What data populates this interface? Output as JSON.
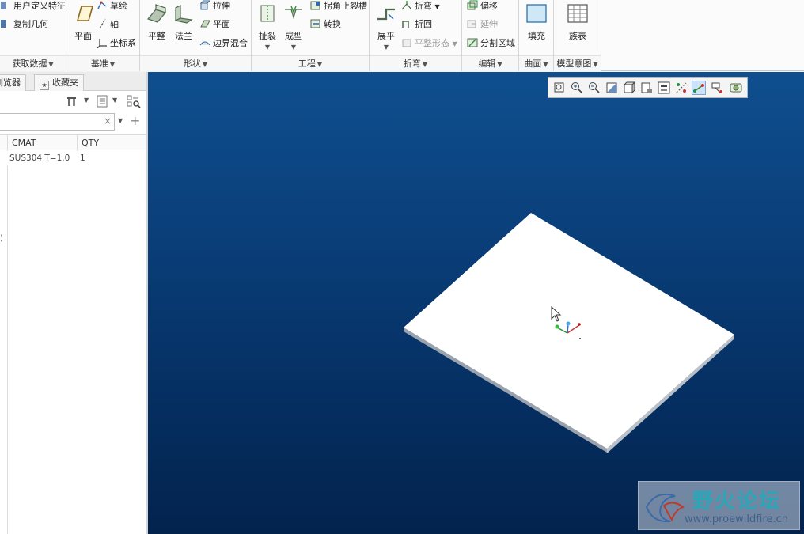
{
  "ribbon": {
    "get_data": {
      "label": "获取数据",
      "items": [
        "用户定义特征",
        "复制几何"
      ]
    },
    "datum": {
      "label": "基准",
      "plane": "平面",
      "items": [
        "草绘",
        "轴",
        "坐标系"
      ]
    },
    "shapes": {
      "label": "形状",
      "flat": "平整",
      "flange": "法兰",
      "items": [
        "拉伸",
        "平面",
        "边界混合"
      ]
    },
    "engineering": {
      "label": "工程",
      "rip": "扯裂",
      "form": "成型",
      "items": [
        "拐角止裂槽",
        "转换"
      ]
    },
    "bends": {
      "label": "折弯",
      "unbend": "展平",
      "items": [
        "折弯",
        "折回",
        "平整形态"
      ]
    },
    "editing": {
      "label": "编辑",
      "items": [
        "偏移",
        "延伸",
        "分割区域"
      ]
    },
    "surfaces": {
      "label": "曲面",
      "fill": "填充"
    },
    "model_intent": {
      "label": "模型意图",
      "family_table": "族表"
    }
  },
  "left_panel": {
    "tabs": [
      "浏览器",
      "收藏夹"
    ],
    "search_placeholder": "",
    "columns": [
      "CMAT",
      "QTY"
    ],
    "rows": [
      [
        "SUS304 T=1.0",
        "1"
      ]
    ],
    "edge_char": ")"
  },
  "watermark": {
    "title": "野火论坛",
    "url": "www.proewildfire.cn"
  },
  "colors": {
    "viewport_top": "#0f4f8f",
    "viewport_bottom": "#03234d",
    "sheet": "#ffffff"
  }
}
